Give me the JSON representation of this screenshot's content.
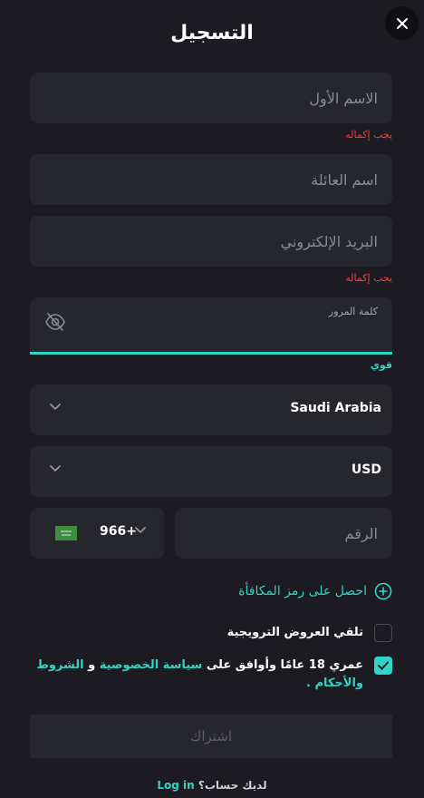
{
  "header": {
    "title": "التسجيل",
    "close_icon": "close-icon"
  },
  "form": {
    "first_name": {
      "value": "",
      "placeholder": "الاسم الأول",
      "error": "يجب إكماله"
    },
    "last_name": {
      "value": "",
      "placeholder": "اسم العائلة"
    },
    "email": {
      "value": "",
      "placeholder": "البريد الإلكتروني",
      "error": "يجب إكماله"
    },
    "password": {
      "label": "كلمة المرور",
      "value": "",
      "strength": "قوي",
      "visibility_icon": "eye-off-icon"
    },
    "country": {
      "value": "Saudi Arabia"
    },
    "currency": {
      "value": "USD"
    },
    "phone": {
      "code": "966+",
      "flag": "saudi-flag",
      "value": "",
      "placeholder": "الرقم"
    },
    "bonus_code_label": "احصل على رمز المكافأة",
    "promo_label": "تلقي العروض الترويجية",
    "promo_checked": false,
    "terms": {
      "checked": true,
      "prefix": "عمري 18 عامًا وأوافق على",
      "privacy_link": "سياسة الخصوصية",
      "and": "و",
      "terms_link": "الشروط والأحكام",
      "suffix": "."
    },
    "submit_label": "اشتراك"
  },
  "footer": {
    "question": "لديك حساب؟",
    "login_link": "Log in"
  },
  "colors": {
    "background": "#1b1b21",
    "field": "#26262d",
    "accent": "#2fd5c6",
    "error": "#ff3b3b"
  }
}
